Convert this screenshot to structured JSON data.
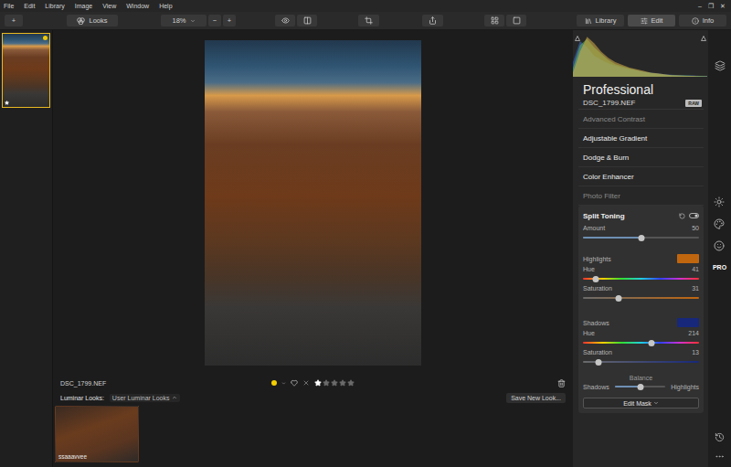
{
  "window": {
    "menu": [
      "File",
      "Edit",
      "Library",
      "Image",
      "View",
      "Window",
      "Help"
    ],
    "controls": [
      "–",
      "❐",
      "✕"
    ]
  },
  "toolbar": {
    "add": "+",
    "looks": "Looks",
    "zoom": "18%",
    "zoom_out": "−",
    "zoom_in": "+",
    "modes": [
      {
        "label": "Library",
        "selected": false
      },
      {
        "label": "Edit",
        "selected": true
      },
      {
        "label": "Info",
        "selected": false
      }
    ]
  },
  "filmstrip": {
    "items": [
      {
        "selected": true,
        "color": "#f0c800",
        "stars": 1
      }
    ]
  },
  "image": {
    "filename": "DSC_1799.NEF",
    "color": "#f5d000",
    "favorite": false,
    "rejected": false,
    "stars": 1
  },
  "looks": {
    "label": "Luminar Looks:",
    "category": "User Luminar Looks",
    "save": "Save New Look...",
    "items": [
      {
        "name": "ssaaavvee",
        "selected": false
      }
    ]
  },
  "histogram": {
    "series": [
      {
        "name": "blue",
        "color": "#3a6fd0",
        "values": [
          35,
          85,
          70,
          50,
          40,
          32,
          26,
          22,
          18,
          15,
          12,
          10,
          8,
          6,
          5,
          4,
          3,
          3,
          2,
          2
        ]
      },
      {
        "name": "green",
        "color": "#5fb85a",
        "values": [
          20,
          75,
          90,
          70,
          55,
          40,
          30,
          25,
          20,
          16,
          12,
          9,
          7,
          5,
          4,
          3,
          3,
          2,
          2,
          1
        ]
      },
      {
        "name": "red",
        "color": "#d8b048",
        "values": [
          10,
          60,
          95,
          80,
          60,
          45,
          35,
          28,
          22,
          18,
          14,
          10,
          8,
          6,
          4,
          3,
          2,
          2,
          1,
          1
        ]
      }
    ]
  },
  "panel": {
    "title": "Professional",
    "file": "DSC_1799.NEF",
    "badge": "RAW",
    "tools": [
      {
        "name": "Advanced Contrast",
        "applied": false
      },
      {
        "name": "Adjustable Gradient",
        "applied": true
      },
      {
        "name": "Dodge & Burn",
        "applied": true
      },
      {
        "name": "Color Enhancer",
        "applied": true
      },
      {
        "name": "Photo Filter",
        "applied": false
      }
    ],
    "split_toning": {
      "title": "Split Toning",
      "enabled": true,
      "amount": {
        "label": "Amount",
        "reading": "50",
        "level": 0.5,
        "kind": "plain"
      },
      "groups": [
        {
          "label": "Highlights",
          "color": "#c0660e",
          "sliders": [
            {
              "label": "Hue",
              "reading": "41",
              "level": 0.114,
              "kind": "hue"
            },
            {
              "label": "Saturation",
              "reading": "31",
              "level": 0.31,
              "kind": "saturation"
            }
          ]
        },
        {
          "label": "Shadows",
          "color": "#17287a",
          "sliders": [
            {
              "label": "Hue",
              "reading": "214",
              "level": 0.594,
              "kind": "hue"
            },
            {
              "label": "Saturation",
              "reading": "13",
              "level": 0.13,
              "kind": "saturation"
            }
          ]
        }
      ],
      "balance": {
        "label": "Balance",
        "left": "Shadows",
        "right": "Highlights",
        "level": 0.5,
        "kind": "plain"
      },
      "edit_mask": "Edit Mask"
    }
  },
  "side_tabs": [
    {
      "selected": false
    },
    {
      "selected": false
    },
    {
      "selected": false
    },
    {
      "label": "PRO",
      "selected": true
    }
  ]
}
